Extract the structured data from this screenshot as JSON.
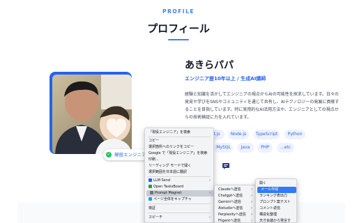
{
  "header": {
    "eyebrow": "PROFILE",
    "title": "プロフィール"
  },
  "profile": {
    "name": "あきらパパ",
    "role": "エンジニア歴10年以上 / 生成AI講師",
    "bio": "経験と知識を活かしてエンジニアの視点からAIの可能性を探求しています。日々の発見や学びをSNSやコミュニティを通じて共有し、AIテクノロジーの発展に貢献することを目指しています。特に実用的なAI活用方法や、エンジニアとしての視点からの技術検証に力を入れています。",
    "badge": "現役エンジニア",
    "tags_row1": [
      "t.js",
      "Node.js",
      "TypeScript",
      "Python"
    ],
    "tags_row2": [
      "MySQL",
      "Java",
      "PHP",
      "...etc"
    ]
  },
  "context_menu": {
    "items": [
      "「現役エンジニア」を検索",
      "コピー",
      "選択箇所へのリンクをコピー",
      "Google で「現役エンジニア」を検索",
      "印刷...",
      "リーディング モードで開く",
      "選択範囲を日本語に翻訳",
      "LLM Send",
      "Open TasksBoard",
      "Prompt Magnet",
      "ページ全体をキャプチャ",
      "検証",
      "スピーチ"
    ]
  },
  "submenu_llm": {
    "items": [
      "Claudeへ送信",
      "Chatgptへ送信",
      "Geminiへ送信",
      "Aistudioへ送信",
      "Perplexityへ送信",
      "Fligentへ送信",
      "Grokへ送信"
    ]
  },
  "submenu_actions": {
    "items": [
      "開く",
      "メール作成",
      "ランキング表出力",
      "プロンプト案テスト",
      "コメント返信",
      "構造化整理",
      "天才会議から発言す"
    ]
  },
  "colors": {
    "accent": "#3b82f6",
    "highlight": "#2f7cf6"
  }
}
